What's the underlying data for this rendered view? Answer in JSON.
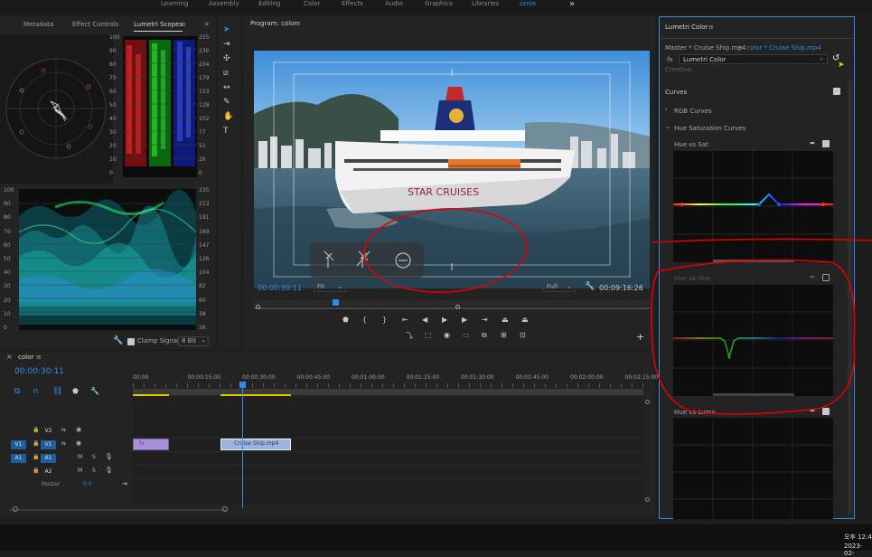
{
  "workspace": {
    "tabs": [
      "Learning",
      "Assembly",
      "Editing",
      "Color",
      "Effects",
      "Audio",
      "Graphics",
      "Libraries",
      "sznie"
    ],
    "active": "sznie",
    "more": "»"
  },
  "left_panel": {
    "tabs": [
      "Metadata",
      "Effect Controls",
      "Lumetri Scopes"
    ],
    "active": "Lumetri Scopes",
    "menu": "≡",
    "more": "»",
    "parade_scale": [
      "100",
      "90",
      "80",
      "70",
      "60",
      "50",
      "40",
      "30",
      "20",
      "10",
      "0"
    ],
    "parade_right_scale": [
      "255",
      "230",
      "204",
      "179",
      "153",
      "128",
      "102",
      "77",
      "51",
      "26",
      "0"
    ],
    "waveform_scale": [
      "100",
      "90",
      "80",
      "70",
      "60",
      "50",
      "40",
      "30",
      "20",
      "10",
      "0"
    ],
    "waveform_right_scale": [
      "235",
      "213",
      "191",
      "169",
      "147",
      "126",
      "104",
      "82",
      "60",
      "38",
      "16"
    ],
    "clamp_label": "Clamp Signal",
    "bit_depth": "8 Bit"
  },
  "program": {
    "title": "Program: color",
    "menu": "≡",
    "timecode": "00:00:30:11",
    "fit": "Fit",
    "quality": "Full",
    "duration": "00:09:16:26",
    "plus": "+"
  },
  "timeline": {
    "title": "color",
    "menu": "≡",
    "timecode": "00:00:30:11",
    "ruler": [
      "00:00",
      "00:00:15:00",
      "00:00:30:00",
      "00:00:45:00",
      "00:01:00:00",
      "00:01:15:00",
      "00:01:30:00",
      "00:01:45:00",
      "00:02:00:00",
      "00:02:15:00"
    ],
    "tracks": [
      {
        "id": "V2",
        "src": ""
      },
      {
        "id": "V1",
        "src": "V1"
      },
      {
        "id": "A1",
        "src": "A1"
      },
      {
        "id": "A2",
        "src": ""
      }
    ],
    "audio_buttons": [
      "M",
      "S"
    ],
    "master_label": "Master",
    "master_value": "0.0",
    "clip1_label": "fx",
    "clip2_label": "Cruise Ship.mp4"
  },
  "lumetri": {
    "title": "Lumetri Color",
    "menu": "≡",
    "master_label": "Master * Cruise Ship.mp4",
    "sequence_label": "color * Cruise Ship.mp4",
    "fx_label": "fx",
    "effect_name": "Lumetri Color",
    "creative": "Creative",
    "curves": "Curves",
    "rgb_curves": "RGB Curves",
    "hue_sat_curves": "Hue Saturation Curves",
    "hue_vs_sat": "Hue vs Sat",
    "hue_vs_hue": "Hue vs Hue",
    "hue_vs_luma": "Hue vs Luma"
  },
  "taskbar": {
    "time": "오후 12:4",
    "date": "2023-02-"
  },
  "colors": {
    "accent": "#2d8ceb",
    "annotation": "#e00000",
    "panel": "#232323",
    "background": "#1d1d1d"
  }
}
